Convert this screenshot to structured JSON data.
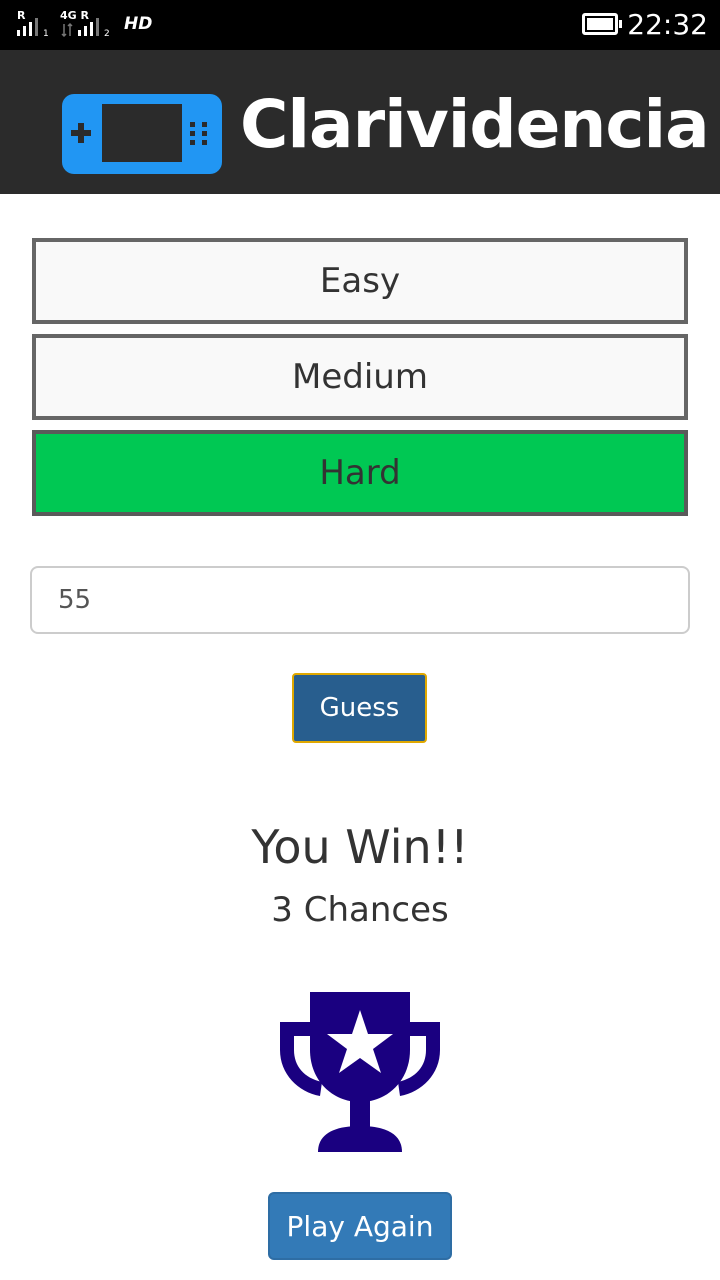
{
  "status_bar": {
    "sim1_label": "R",
    "sim1_slot": "1",
    "sim2_label": "4G R",
    "sim2_slot": "2",
    "hd_label": "HD",
    "time": "22:32"
  },
  "header": {
    "title": "Clarividencia",
    "logo_icon": "gamepad-icon",
    "logo_color": "#2196f3",
    "background": "#2b2b2b"
  },
  "difficulty": {
    "options": [
      {
        "label": "Easy",
        "selected": false
      },
      {
        "label": "Medium",
        "selected": false
      },
      {
        "label": "Hard",
        "selected": true
      }
    ],
    "selected_color": "#00c853"
  },
  "guess": {
    "input_value": "55",
    "button_label": "Guess"
  },
  "result": {
    "title": "You Win!!",
    "chances": "3 Chances",
    "trophy_icon": "trophy-icon",
    "trophy_color": "#1a0080"
  },
  "play_again": {
    "label": "Play Again"
  }
}
